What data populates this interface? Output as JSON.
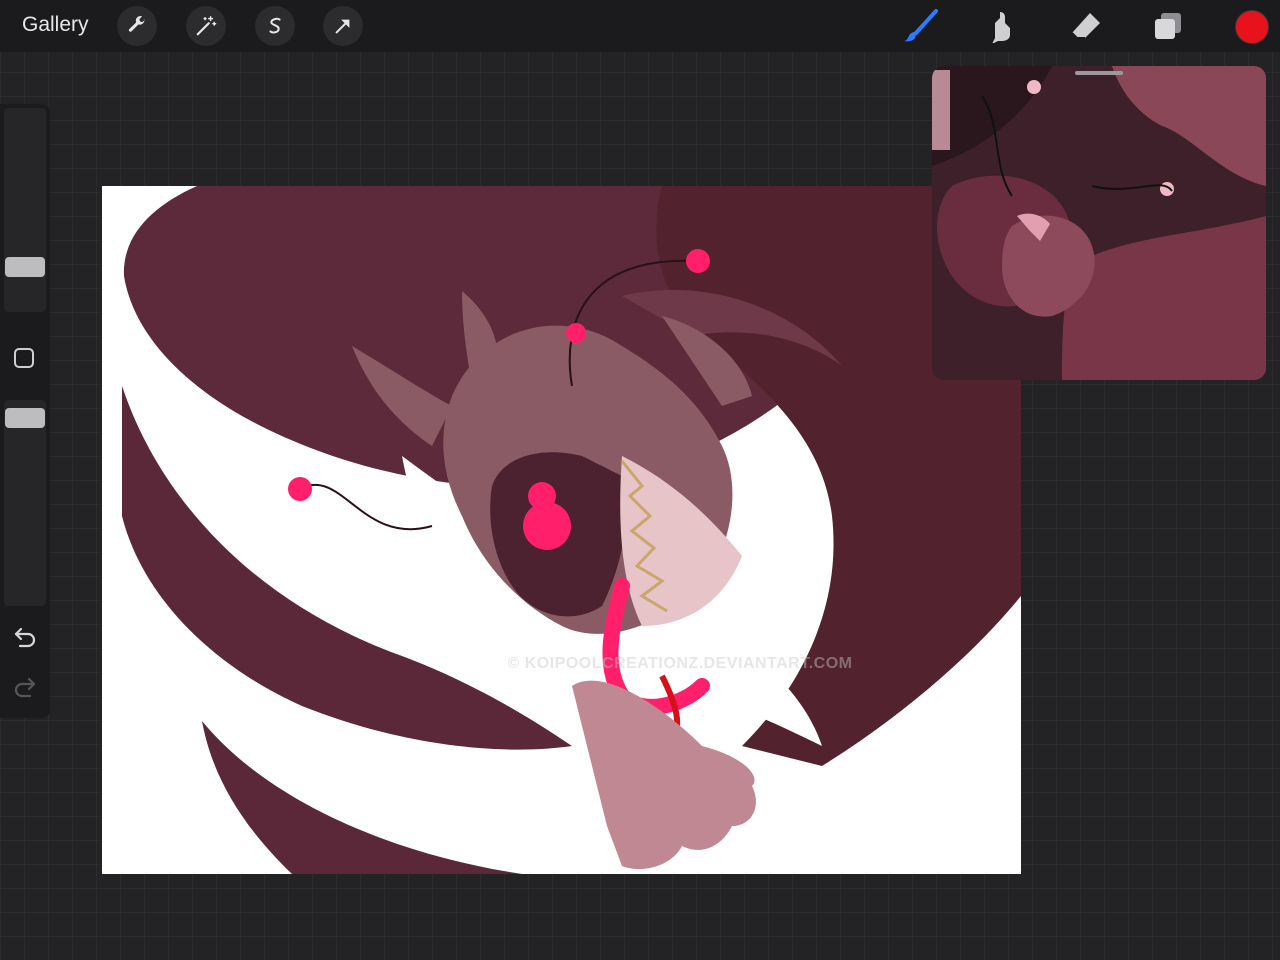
{
  "toolbar": {
    "gallery_label": "Gallery",
    "left_tools": [
      "wrench-icon",
      "magic-wand-icon",
      "selection-icon",
      "transform-arrow-icon"
    ],
    "right_tools": [
      "brush-icon",
      "smudge-icon",
      "eraser-icon",
      "layers-icon"
    ],
    "active_tool": "brush-icon",
    "current_color": "#e8121c",
    "accent": "#2b7cff"
  },
  "sidebar": {
    "controls": [
      "brush-size-slider",
      "modify-button",
      "opacity-slider",
      "undo-icon",
      "redo-icon"
    ]
  },
  "canvas": {
    "watermark": "© KOIPOOLCREATIONZ.DEVIANTART.COM"
  },
  "reference_window": {
    "label": "reference-image"
  }
}
